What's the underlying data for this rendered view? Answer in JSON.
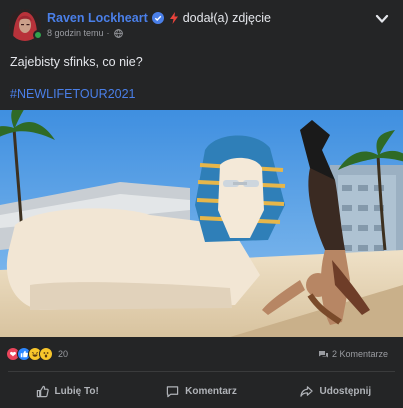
{
  "post": {
    "author": "Raven Lockheart",
    "action": "dodał(a) zdjęcie",
    "time": "8 godzin temu",
    "meta_sep": "·",
    "text": "Zajebisty sfinks, co nie?",
    "hashtag": "#NEWLIFETOUR2021"
  },
  "icons": {
    "verified": "verified-badge-icon",
    "bolt": "lightning-bolt-icon",
    "globe": "globe-icon",
    "more": "chevron-down-icon",
    "comment": "comment-bubble-icon",
    "like": "thumbs-up-icon",
    "share": "share-arrow-icon"
  },
  "reactions": {
    "types": [
      "heart",
      "like",
      "haha",
      "wow"
    ],
    "count": "20",
    "comments": "2 Komentarze"
  },
  "actions": {
    "like": "Lubię To!",
    "comment": "Komentarz",
    "share": "Udostępnij"
  },
  "colors": {
    "background": "#242526",
    "accent": "#4a7fe8",
    "muted": "#9a9ca1",
    "online": "#31a24c"
  }
}
